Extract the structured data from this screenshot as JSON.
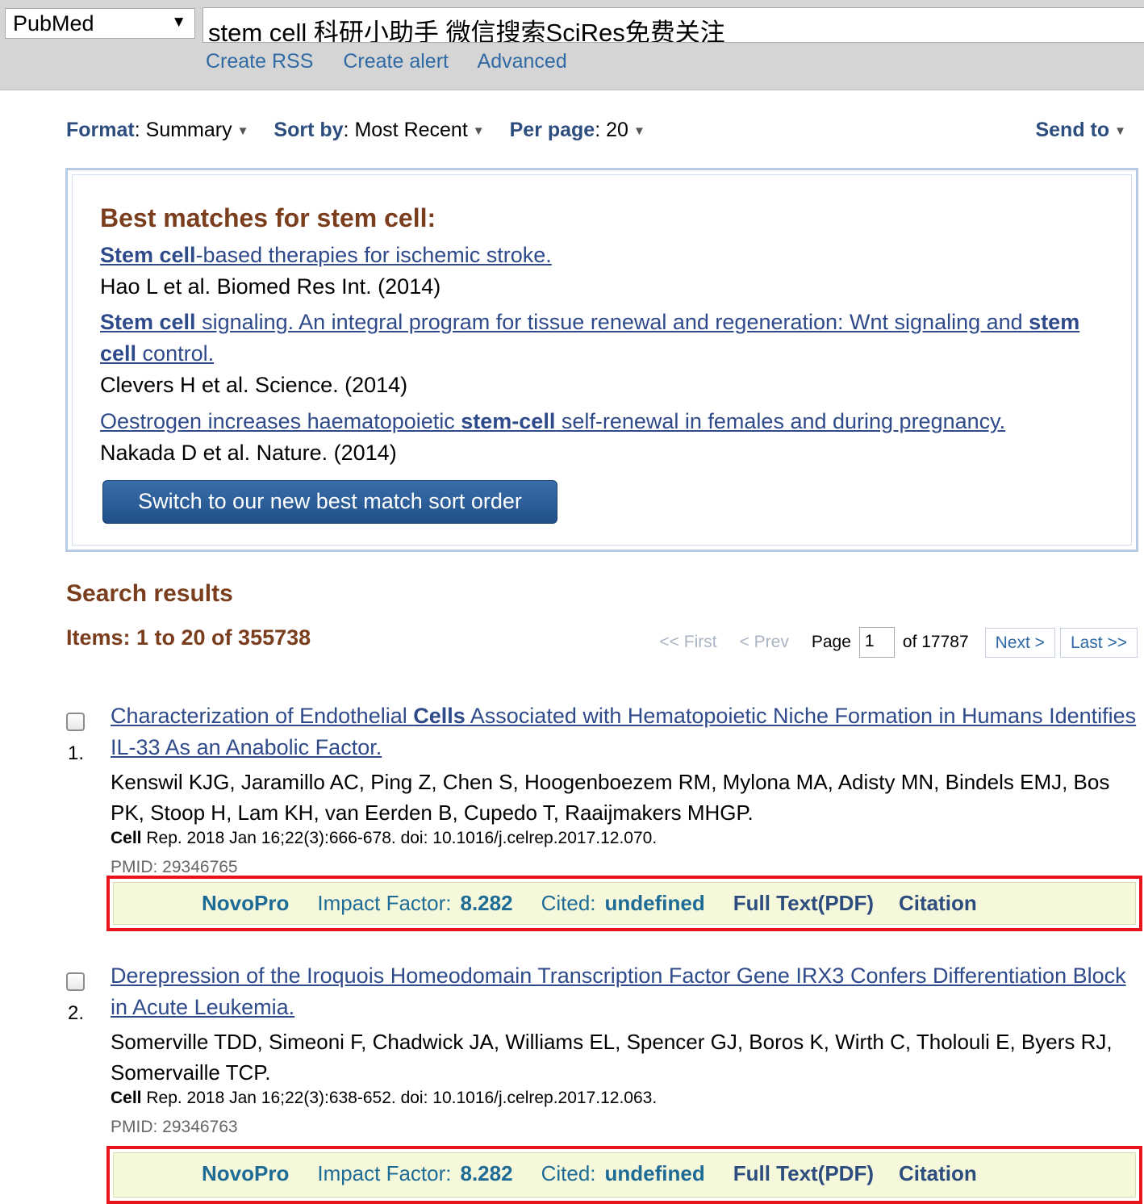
{
  "search": {
    "database": "PubMed",
    "query": "stem cell 科研小助手 微信搜索SciRes免费关注",
    "links": [
      "Create RSS",
      "Create alert",
      "Advanced"
    ]
  },
  "settings": {
    "format_label": "Format",
    "format_value": "Summary",
    "sort_label": "Sort by",
    "sort_value": "Most Recent",
    "per_page_label": "Per page",
    "per_page_value": "20",
    "send_to": "Send to"
  },
  "best_matches": {
    "title": "Best matches for stem cell:",
    "items": [
      {
        "title_bold_1": "Stem cell",
        "title_1": "-based therapies for ischemic stroke.",
        "title_bold_2": "",
        "title_2": "",
        "source": "Hao L et al. Biomed Res Int. (2014)"
      },
      {
        "title_bold_1": "Stem cell",
        "title_1": " signaling. An integral program for tissue renewal and regeneration: Wnt signaling and ",
        "title_bold_2": "stem cell",
        "title_2": " control.",
        "source": "Clevers H et al. Science. (2014)"
      },
      {
        "title_pre": "Oestrogen increases haematopoietic ",
        "title_bold_1": "stem-cell",
        "title_1": " self-renewal in females and during pregnancy.",
        "source": "Nakada D et al. Nature. (2014)"
      }
    ],
    "button": "Switch to our new best match sort order"
  },
  "results": {
    "title": "Search results",
    "items_count": "Items: 1 to 20 of 355738",
    "pager": {
      "first": "<< First",
      "prev": "< Prev",
      "page_label": "Page",
      "page_value": "1",
      "of": "of 17787",
      "next": "Next >",
      "last": "Last >>"
    },
    "list": [
      {
        "num": "1.",
        "title_pre": "Characterization of Endothelial ",
        "title_bold": "Cells",
        "title_post": " Associated with Hematopoietic Niche Formation in Humans Identifies IL-33 As an Anabolic Factor.",
        "authors": "Kenswil KJG, Jaramillo AC, Ping Z, Chen S, Hoogenboezem RM, Mylona MA, Adisty MN, Bindels EMJ, Bos PK, Stoop H, Lam KH, van Eerden B, Cupedo T, Raaijmakers MHGP.",
        "journal_bold": "Cell",
        "journal": " Rep. 2018 Jan 16;22(3):666-678. doi: 10.1016/j.celrep.2017.12.070.",
        "pmid": "PMID: 29346765",
        "novo": {
          "brand": "NovoPro",
          "impact_label": "Impact Factor:",
          "impact_value": "8.282",
          "cited_label": "Cited:",
          "cited_value": "undefined",
          "fulltext": "Full Text(PDF)",
          "citation": "Citation"
        }
      },
      {
        "num": "2.",
        "title_pre": "Derepression of the Iroquois Homeodomain Transcription Factor Gene IRX3 Confers Differentiation Block in Acute Leukemia.",
        "title_bold": "",
        "title_post": "",
        "authors": "Somerville TDD, Simeoni F, Chadwick JA, Williams EL, Spencer GJ, Boros K, Wirth C, Tholouli E, Byers RJ, Somervaille TCP.",
        "journal_bold": "Cell",
        "journal": " Rep. 2018 Jan 16;22(3):638-652. doi: 10.1016/j.celrep.2017.12.063.",
        "pmid": "PMID: 29346763",
        "novo": {
          "brand": "NovoPro",
          "impact_label": "Impact Factor:",
          "impact_value": "8.282",
          "cited_label": "Cited:",
          "cited_value": "undefined",
          "fulltext": "Full Text(PDF)",
          "citation": "Citation"
        }
      }
    ]
  },
  "colors": {
    "link": "#2f4a8a",
    "heading_brown": "#7a3e1e",
    "button_blue": "#2a5d98",
    "highlight_red": "#e8141c",
    "novo_bg": "#f6f8dc"
  }
}
